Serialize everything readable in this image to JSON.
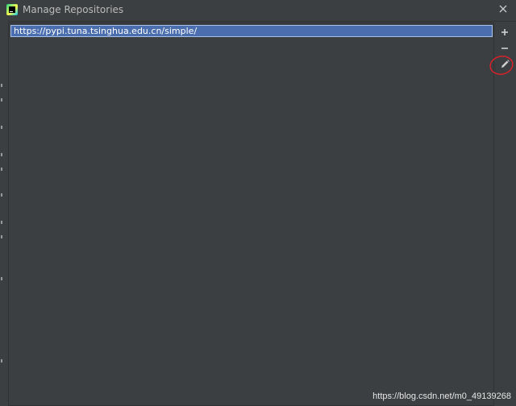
{
  "window": {
    "title": "Manage Repositories"
  },
  "repositories": {
    "items": [
      {
        "url": "https://pypi.tuna.tsinghua.edu.cn/simple/",
        "selected": true
      }
    ]
  },
  "toolbar": {
    "icons": [
      "plus-icon",
      "minus-icon",
      "pencil-icon"
    ]
  },
  "colors": {
    "background": "#3c3f41",
    "selection": "#4b6eaf",
    "selection_border": "#a8c1ea",
    "annotation": "#e0202a"
  },
  "watermark": {
    "text": "https://blog.csdn.net/m0_49139268"
  }
}
